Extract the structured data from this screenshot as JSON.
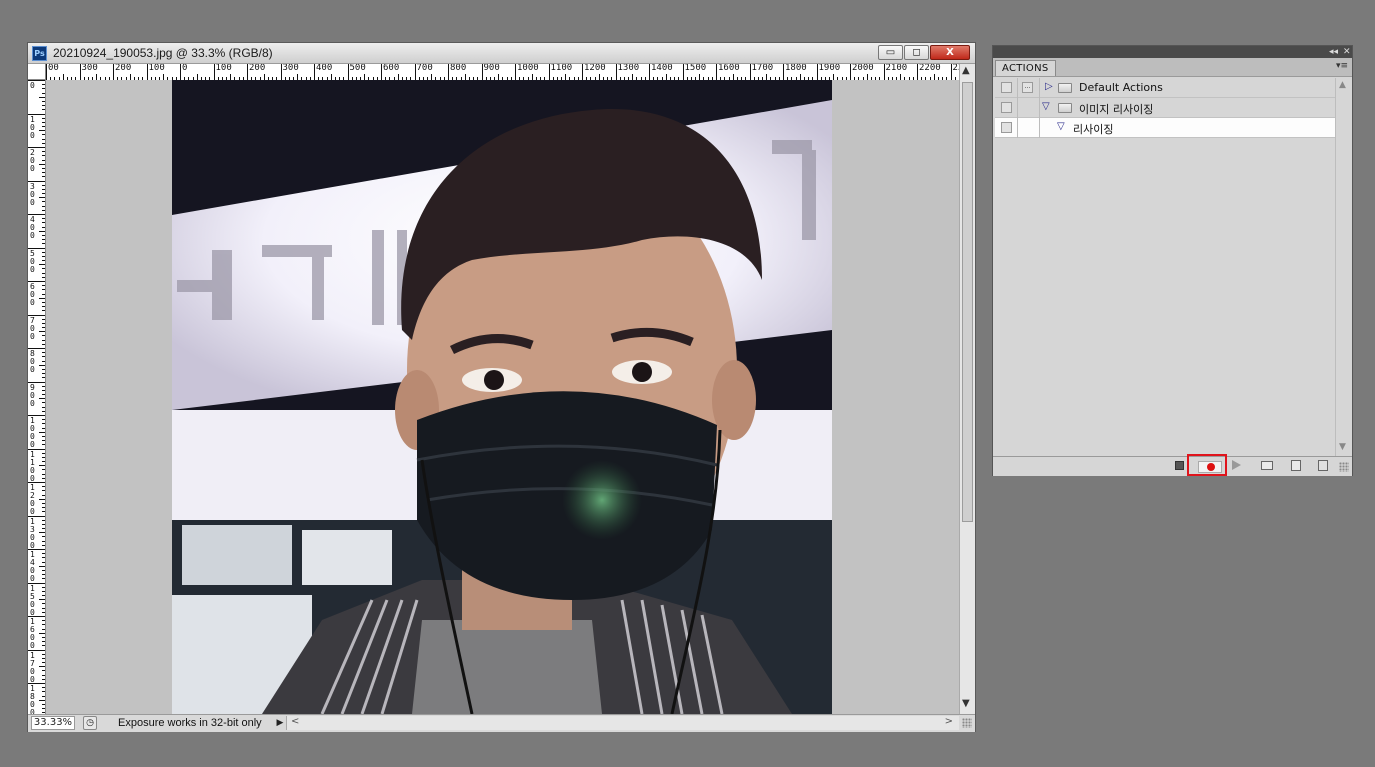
{
  "document": {
    "app_badge": "Ps",
    "title": "20210924_190053.jpg @ 33.3% (RGB/8)",
    "window_buttons": {
      "minimize": "▭",
      "maximize": "◻",
      "close": "X"
    },
    "ruler_top_labels": [
      "00",
      "300",
      "200",
      "100",
      "0",
      "100",
      "200",
      "300",
      "400",
      "500",
      "600",
      "700",
      "800",
      "900",
      "1000",
      "1100",
      "1200",
      "1300",
      "1400",
      "1500",
      "1600",
      "1700",
      "1800",
      "1900",
      "2000",
      "2100",
      "2200",
      "230"
    ],
    "ruler_left_labels": [
      "0",
      "100",
      "200",
      "300",
      "400",
      "500",
      "600",
      "700",
      "800",
      "900",
      "1000",
      "1100",
      "1200",
      "1300",
      "1400",
      "1500",
      "1600",
      "1700",
      "1800",
      "1900"
    ]
  },
  "status_bar": {
    "zoom": "33.33%",
    "info": "Exposure works in 32-bit only",
    "arrow": "▶",
    "scroll_left": "<",
    "scroll_right": ">"
  },
  "actions_panel": {
    "tab": "ACTIONS",
    "collapse_glyph": "◂◂",
    "close_glyph": "✕",
    "menu_glyph": "▾≡",
    "items": [
      {
        "label": "Default Actions",
        "expanded": false,
        "type": "set"
      },
      {
        "label": "이미지 리사이징",
        "expanded": true,
        "type": "set"
      },
      {
        "label": "리사이징",
        "expanded": true,
        "type": "action",
        "selected": true
      }
    ],
    "record_highlighted": true,
    "highlight_color": "#e0141c"
  },
  "colors": {
    "workspace": "#7a7a7a",
    "canvas_background": "#c2c2c2",
    "record_dot": "#dd1111"
  }
}
